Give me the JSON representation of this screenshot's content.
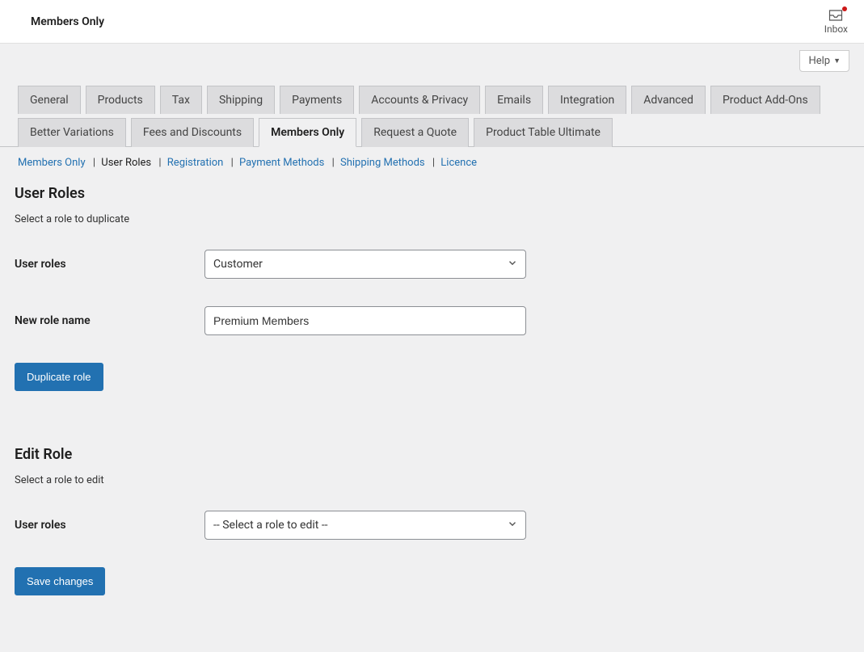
{
  "header": {
    "title": "Members Only",
    "inbox_label": "Inbox",
    "help_label": "Help"
  },
  "tabs": [
    {
      "label": "General"
    },
    {
      "label": "Products"
    },
    {
      "label": "Tax"
    },
    {
      "label": "Shipping"
    },
    {
      "label": "Payments"
    },
    {
      "label": "Accounts & Privacy"
    },
    {
      "label": "Emails"
    },
    {
      "label": "Integration"
    },
    {
      "label": "Advanced"
    },
    {
      "label": "Product Add-Ons"
    },
    {
      "label": "Better Variations"
    },
    {
      "label": "Fees and Discounts"
    },
    {
      "label": "Members Only"
    },
    {
      "label": "Request a Quote"
    },
    {
      "label": "Product Table Ultimate"
    }
  ],
  "subnav": [
    {
      "label": "Members Only"
    },
    {
      "label": "User Roles"
    },
    {
      "label": "Registration"
    },
    {
      "label": "Payment Methods"
    },
    {
      "label": "Shipping Methods"
    },
    {
      "label": "Licence"
    }
  ],
  "section1": {
    "heading": "User Roles",
    "desc": "Select a role to duplicate",
    "field1_label": "User roles",
    "field1_value": "Customer",
    "field2_label": "New role name",
    "field2_value": "Premium Members",
    "button": "Duplicate role"
  },
  "section2": {
    "heading": "Edit Role",
    "desc": "Select a role to edit",
    "field1_label": "User roles",
    "field1_value": "-- Select a role to edit --",
    "button": "Save changes"
  }
}
